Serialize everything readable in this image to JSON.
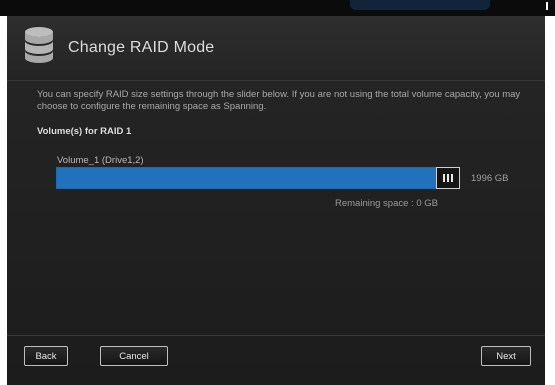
{
  "dialog": {
    "title": "Change RAID Mode",
    "title_icon": "database-icon",
    "description": "You can specify RAID size settings through the slider below. If you are not using the total volume capacity, you may choose to configure the remaining space as Spanning.",
    "section_title": "Volume(s) for RAID 1"
  },
  "volume": {
    "label": "Volume_1 (Drive1,2)",
    "size": "1996 GB",
    "allocation_fraction": 1.0,
    "remaining": "Remaining space : 0 GB",
    "handle_icon": "slider-grip-icon"
  },
  "buttons": {
    "back": "Back",
    "cancel": "Cancel",
    "next": "Next"
  },
  "colors": {
    "accent": "#1f72bb",
    "background": "#222222"
  }
}
